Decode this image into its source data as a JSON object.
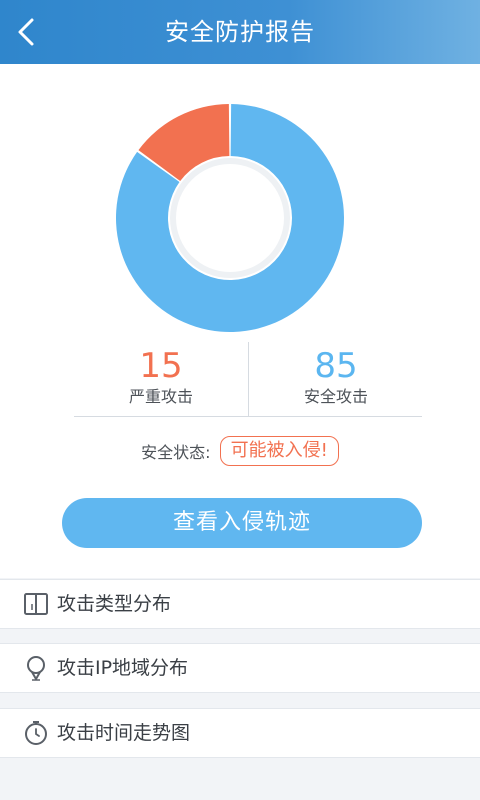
{
  "header": {
    "title": "安全防护报告",
    "back_icon": "chevron-left-icon"
  },
  "report": {
    "donut": {
      "serious_color": "#f27150",
      "safe_color": "#60b7f0",
      "serious_value": 15,
      "safe_value": 85
    },
    "serious": {
      "value": "15",
      "label": "严重攻击"
    },
    "safe": {
      "value": "85",
      "label": "安全攻击"
    },
    "status": {
      "label": "安全状态:",
      "value": "可能被入侵!"
    },
    "action_button": "查看入侵轨迹"
  },
  "menu": [
    {
      "label": "攻击类型分布",
      "icon": "book-icon"
    },
    {
      "label": "攻击IP地域分布",
      "icon": "location-pin-icon"
    },
    {
      "label": "攻击时间走势图",
      "icon": "clock-icon"
    }
  ]
}
